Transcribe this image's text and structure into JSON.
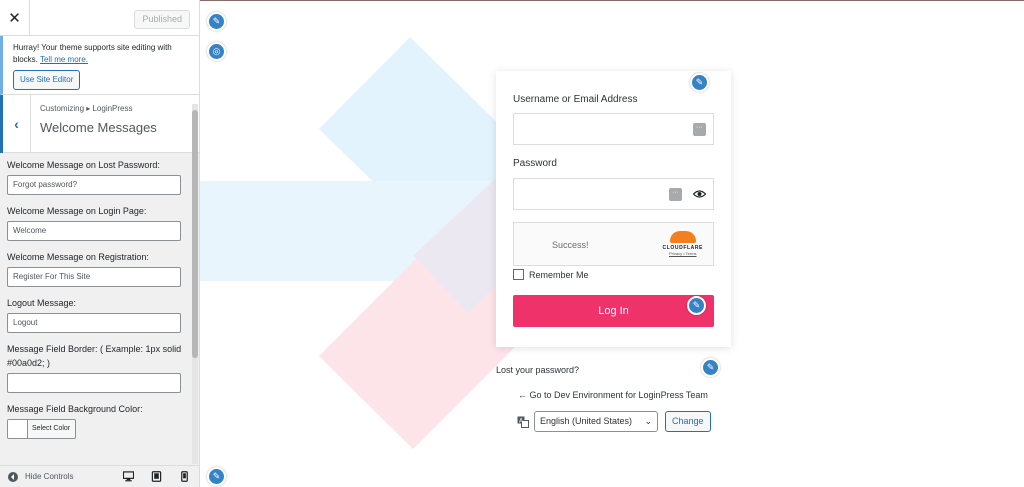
{
  "customizer": {
    "close_label": "✕",
    "published_label": "Published",
    "notice": {
      "text": "Hurray! Your theme supports site editing with blocks.",
      "link": "Tell me more.",
      "button": "Use Site Editor"
    },
    "breadcrumb": "Customizing ▸ LoginPress",
    "section_title": "Welcome Messages",
    "fields": [
      {
        "label": "Welcome Message on Lost Password:",
        "value": "Forgot password?"
      },
      {
        "label": "Welcome Message on Login Page:",
        "value": "Welcome"
      },
      {
        "label": "Welcome Message on Registration:",
        "value": "Register For This Site"
      },
      {
        "label": "Logout Message:",
        "value": "Logout"
      },
      {
        "label": "Message Field Border: ( Example: 1px solid #00a0d2; )",
        "value": ""
      }
    ],
    "color_field": {
      "label": "Message Field Background Color:",
      "button": "Select Color"
    },
    "footer": {
      "hide_controls": "Hide Controls"
    }
  },
  "login_form": {
    "username_label": "Username or Email Address",
    "username_value": "",
    "password_label": "Password",
    "password_value": "",
    "captcha": {
      "status": "Success!",
      "brand": "CLOUDFLARE",
      "links": "Privacy • Terms"
    },
    "remember_label": "Remember Me",
    "login_button": "Log In"
  },
  "below_form": {
    "lost_password": "Lost your password?",
    "go_to_site": "← Go to Dev Environment for LoginPress Team",
    "language_selected": "English (United States)",
    "change_button": "Change"
  },
  "colors": {
    "accent": "#2271b1",
    "login_button": "#f0326b",
    "edit_pin": "#3582c4",
    "bg_shape_blue": "#e3f3fd",
    "bg_shape_pink": "#fde0e5"
  }
}
